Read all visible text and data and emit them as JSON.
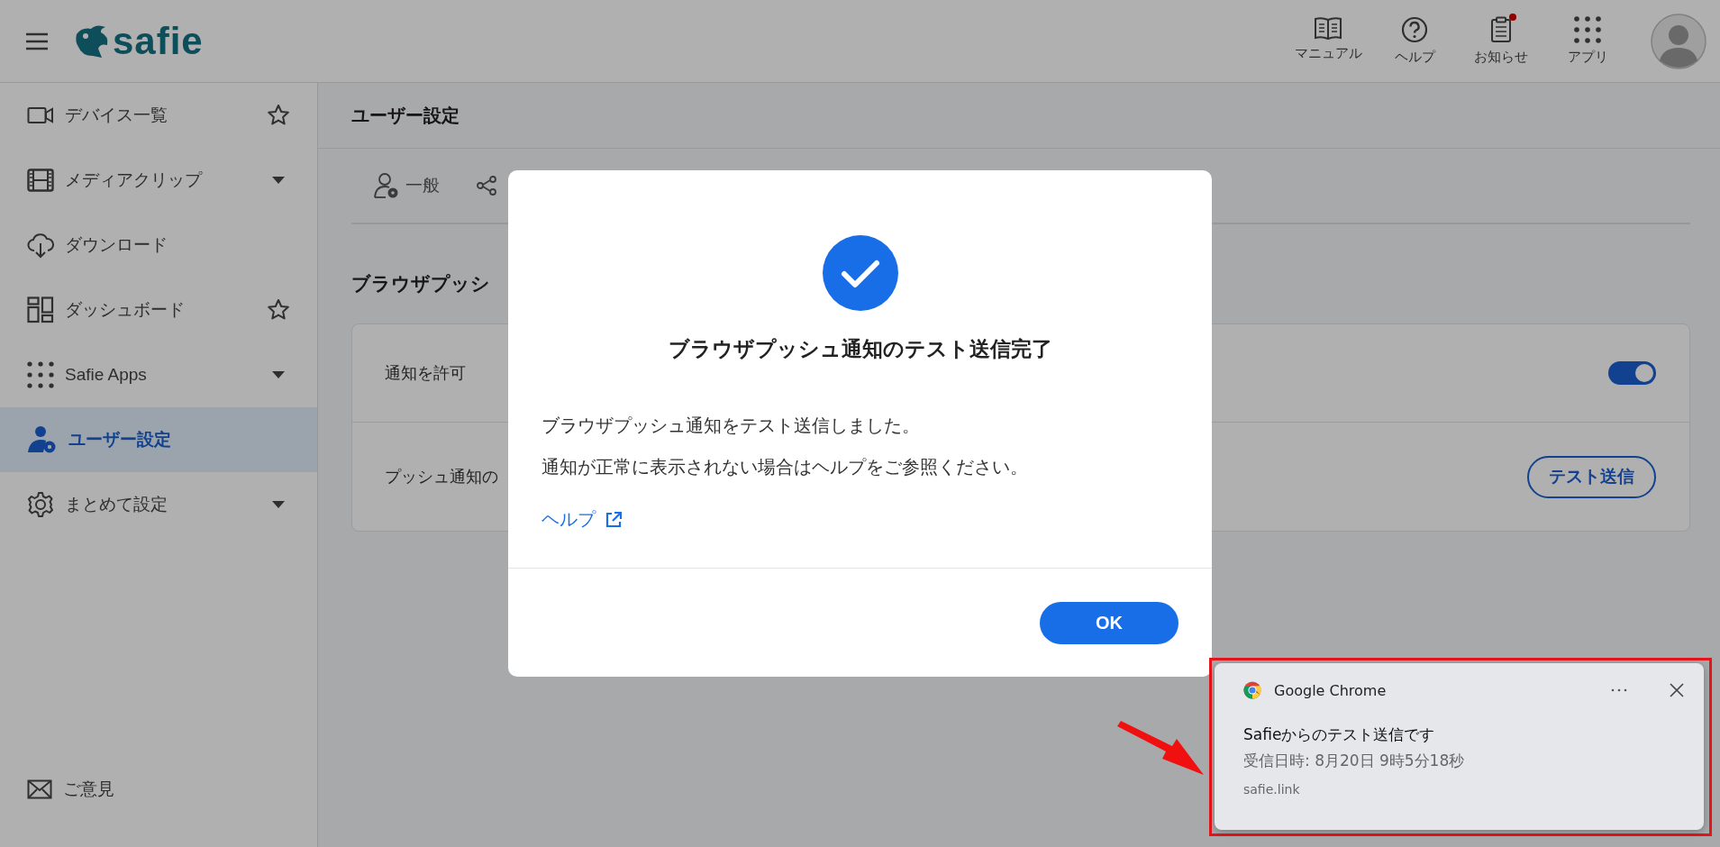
{
  "header": {
    "logo": "safie",
    "nav": [
      {
        "label": "マニュアル",
        "badge": false
      },
      {
        "label": "ヘルプ",
        "badge": false
      },
      {
        "label": "お知らせ",
        "badge": true
      },
      {
        "label": "アプリ",
        "badge": false
      }
    ]
  },
  "sidebar": {
    "items": [
      {
        "label": "デバイス一覧",
        "star": true,
        "dropdown": false,
        "selected": false
      },
      {
        "label": "メディアクリップ",
        "star": false,
        "dropdown": true,
        "selected": false
      },
      {
        "label": "ダウンロード",
        "star": false,
        "dropdown": false,
        "selected": false
      },
      {
        "label": "ダッシュボード",
        "star": true,
        "dropdown": false,
        "selected": false
      },
      {
        "label": "Safie Apps",
        "star": false,
        "dropdown": true,
        "selected": false
      },
      {
        "label": "ユーザー設定",
        "star": false,
        "dropdown": false,
        "selected": true
      },
      {
        "label": "まとめて設定",
        "star": false,
        "dropdown": true,
        "selected": false
      }
    ],
    "footer": {
      "label": "ご意見"
    }
  },
  "page": {
    "title": "ユーザー設定",
    "tabs": [
      {
        "label": "一般"
      }
    ],
    "section_title": "ブラウザプッシ",
    "rows": [
      {
        "kind": "toggle",
        "label": "通知を許可",
        "on": true
      },
      {
        "kind": "action",
        "label": "プッシュ通知の",
        "button": "テスト送信"
      }
    ]
  },
  "dialog": {
    "title": "ブラウザプッシュ通知のテスト送信完了",
    "lines": [
      "ブラウザプッシュ通知をテスト送信しました。",
      "通知が正常に表示されない場合はヘルプをご参照ください。"
    ],
    "link": "ヘルプ",
    "ok": "OK"
  },
  "notification": {
    "app": "Google Chrome",
    "title": "Safieからのテスト送信です",
    "body": "受信日時: 8月20日 9時5分18秒",
    "source": "safie.link"
  }
}
